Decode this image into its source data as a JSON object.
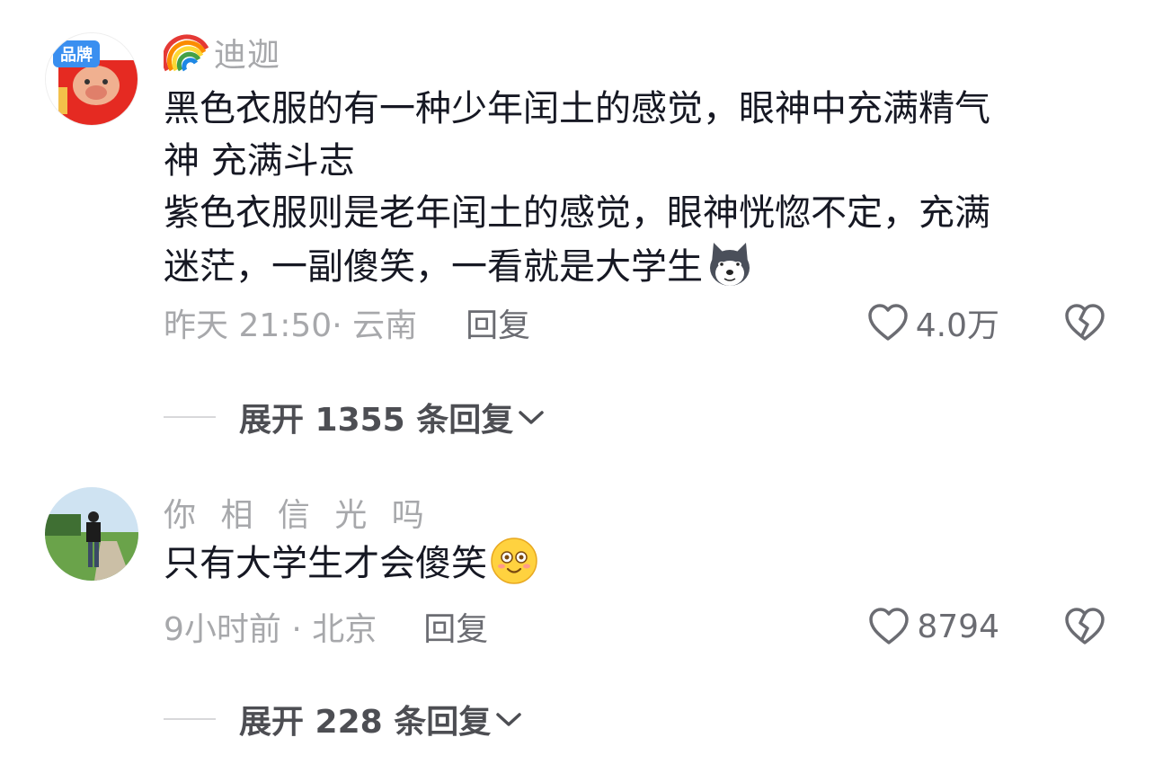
{
  "comments": [
    {
      "badge": "品牌",
      "username": "迪迦",
      "text_lines": [
        "黑色衣服的有一种少年闰土的感觉，眼神中充满精气",
        "神 充满斗志",
        "紫色衣服则是老年闰土的感觉，眼神恍惚不定，充满",
        "迷茫，一副傻笑，一看就是大学生"
      ],
      "emoji": "husky-dog-emoji",
      "time_location": "昨天 21:50· 云南",
      "reply_label": "回复",
      "like_count": "4.0万",
      "expand_label": "展开 1355 条回复"
    },
    {
      "username": "你 相 信 光 吗",
      "text_lines": [
        "只有大学生才会傻笑"
      ],
      "emoji": "smiling-face-emoji",
      "time_location": "9小时前 · 北京",
      "reply_label": "回复",
      "like_count": "8794",
      "expand_label": "展开 228 条回复"
    }
  ],
  "colors": {
    "primary_text": "#161823",
    "secondary_text": "#a7a8ab",
    "action_text": "#6b6c72",
    "badge_blue": "#3a8ff0"
  },
  "icons": [
    "rainbow-icon",
    "heart-outline-icon",
    "broken-heart-icon",
    "chevron-down-icon"
  ]
}
